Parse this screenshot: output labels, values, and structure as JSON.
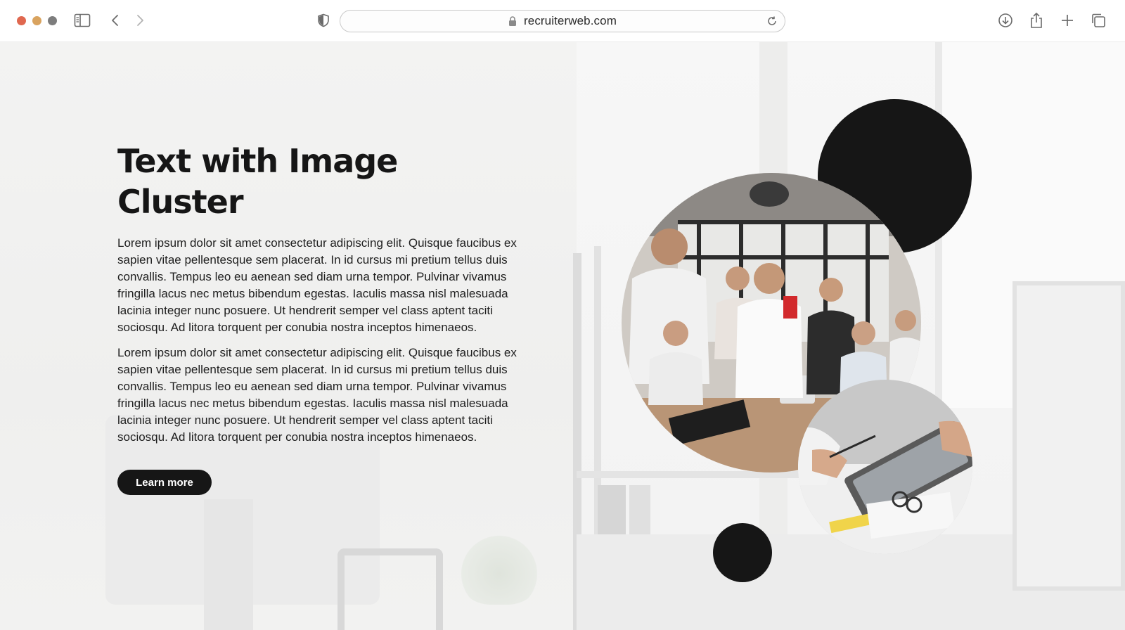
{
  "browser": {
    "url": "recruiterweb.com",
    "icons": {
      "sidebar": "sidebar-icon",
      "back": "chevron-left-icon",
      "forward": "chevron-right-icon",
      "privacy": "shield-icon",
      "lock": "lock-icon",
      "reload": "reload-icon",
      "download": "download-icon",
      "share": "share-icon",
      "new_tab": "plus-icon",
      "tabs": "tabs-overview-icon"
    }
  },
  "hero": {
    "title": "Text with Image Cluster",
    "paragraphs": [
      "Lorem ipsum dolor sit amet consectetur adipiscing elit. Quisque faucibus ex sapien vitae pellentesque sem placerat. In id cursus mi pretium tellus duis convallis. Tempus leo eu aenean sed diam urna tempor. Pulvinar vivamus fringilla lacus nec metus bibendum egestas. Iaculis massa nisl malesuada lacinia integer nunc posuere. Ut hendrerit semper vel class aptent taciti sociosqu. Ad litora torquent per conubia nostra inceptos himenaeos.",
      "Lorem ipsum dolor sit amet consectetur adipiscing elit. Quisque faucibus ex sapien vitae pellentesque sem placerat. In id cursus mi pretium tellus duis convallis. Tempus leo eu aenean sed diam urna tempor. Pulvinar vivamus fringilla lacus nec metus bibendum egestas. Iaculis massa nisl malesuada lacinia integer nunc posuere. Ut hendrerit semper vel class aptent taciti sociosqu. Ad litora torquent per conubia nostra inceptos himenaeos."
    ],
    "cta_label": "Learn more"
  },
  "colors": {
    "accent": "#161616",
    "text": "#1e1e1e",
    "button_text": "#ffffff"
  }
}
